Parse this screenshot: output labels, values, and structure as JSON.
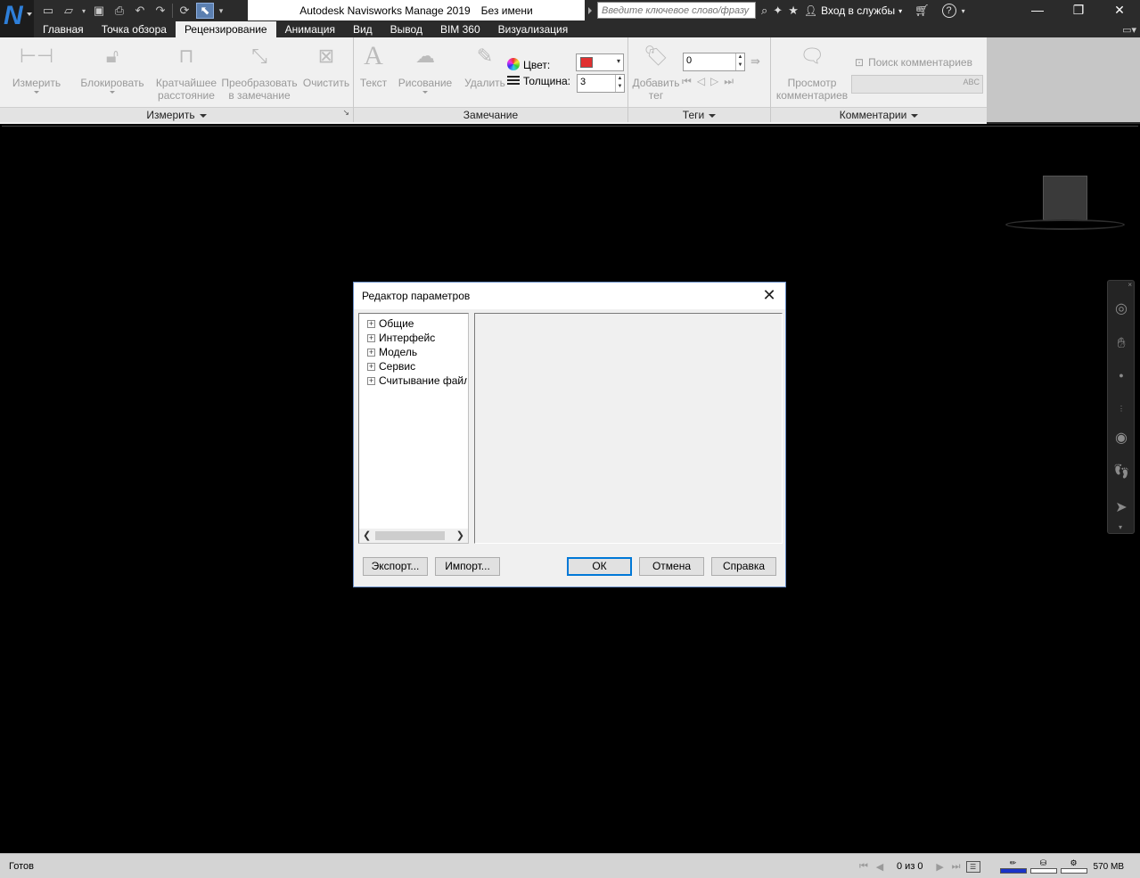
{
  "titlebar": {
    "app_name": "Autodesk Navisworks Manage 2019",
    "document": "Без имени",
    "search_placeholder": "Введите ключевое слово/фразу",
    "signin_label": "Вход в службы",
    "help_label": "?"
  },
  "tabs": [
    {
      "label": "Главная",
      "active": false
    },
    {
      "label": "Точка обзора",
      "active": false
    },
    {
      "label": "Рецензирование",
      "active": true
    },
    {
      "label": "Анимация",
      "active": false
    },
    {
      "label": "Вид",
      "active": false
    },
    {
      "label": "Вывод",
      "active": false
    },
    {
      "label": "BIM 360",
      "active": false
    },
    {
      "label": "Визуализация",
      "active": false
    }
  ],
  "ribbon": {
    "measure_panel": {
      "title": "Измерить",
      "buttons": [
        "Измерить",
        "Блокировать",
        "Кратчайшее расстояние",
        "Преобразовать в замечание",
        "Очистить"
      ]
    },
    "redline_panel": {
      "title": "Замечание",
      "buttons": [
        "Текст",
        "Рисование",
        "Удалить"
      ],
      "color_label": "Цвет:",
      "color_value": "#e03030",
      "thickness_label": "Толщина:",
      "thickness_value": "3"
    },
    "tags_panel": {
      "title": "Теги",
      "add_tag_label": "Добавить тег",
      "tag_value": "0"
    },
    "comments_panel": {
      "title": "Комментарии",
      "view_comments_label": "Просмотр комментариев",
      "find_comments_label": "Поиск комментариев"
    }
  },
  "dialog": {
    "title": "Редактор параметров",
    "tree": [
      "Общие",
      "Интерфейс",
      "Модель",
      "Сервис",
      "Считывание файлов"
    ],
    "buttons": {
      "export": "Экспорт...",
      "import": "Импорт...",
      "ok": "ОК",
      "cancel": "Отмена",
      "help": "Справка"
    }
  },
  "statusbar": {
    "status": "Готов",
    "sheet_counter": "0 из 0",
    "memory": "570 MB",
    "memory_fill_fraction": 1.0
  }
}
